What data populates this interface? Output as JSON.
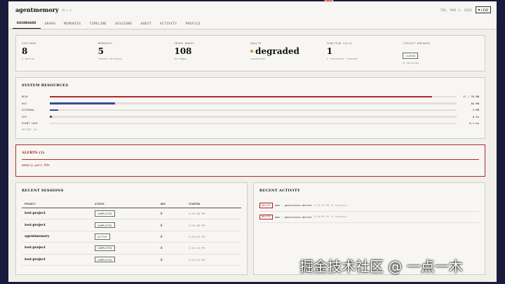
{
  "app": {
    "brand": "agentmemory",
    "version": "v0.x.x",
    "date": "TUE, MAR 3, 2026",
    "live_label": "LIVE"
  },
  "nav": [
    {
      "label": "DASHBOARD",
      "active": true
    },
    {
      "label": "GRAPH"
    },
    {
      "label": "MEMORIES"
    },
    {
      "label": "TIMELINE"
    },
    {
      "label": "SESSIONS"
    },
    {
      "label": "AUDIT"
    },
    {
      "label": "ACTIVITY"
    },
    {
      "label": "PROFILE"
    }
  ],
  "stats": {
    "sessions": {
      "label": "SESSIONS",
      "value": "8",
      "sub": "2 active"
    },
    "memories": {
      "label": "MEMORIES",
      "value": "5",
      "sub": "latest versions"
    },
    "graph": {
      "label": "GRAPH NODES",
      "value": "108",
      "sub": "84 edges"
    },
    "health": {
      "label": "HEALTH",
      "value": "degraded",
      "sub": "connected",
      "color": "#c8a24a"
    },
    "functions": {
      "label": "FUNCTION CALLS",
      "value": "1",
      "sub": "1 functions tracked"
    },
    "breaker": {
      "label": "CIRCUIT BREAKER",
      "value": "CLOSED",
      "sub": "0 failures"
    }
  },
  "resources": {
    "title": "SYSTEM RESOURCES",
    "rows": [
      {
        "label": "HEAP",
        "value": "17 / 18 MB",
        "fraction": 0.94,
        "color": "#b02a2a"
      },
      {
        "label": "RSS",
        "value": "84 MB",
        "fraction": 0.16,
        "color": "#3a4a9a"
      },
      {
        "label": "EXTERNAL",
        "value": "3 MB",
        "fraction": 0.02,
        "color": "#3a4a9a"
      },
      {
        "label": "CPU",
        "value": "0.5%",
        "fraction": 0.005,
        "color": "#555555"
      },
      {
        "label": "EVENT LOOP",
        "value": "0.1 ms",
        "fraction": 0.0,
        "color": "#555555"
      }
    ],
    "uptime": "UPTIME: 5m"
  },
  "alerts": {
    "title": "ALERTS (1)",
    "items": [
      "memory_warn_94%"
    ]
  },
  "sessions": {
    "title": "RECENT SESSIONS",
    "headers": [
      "PROJECT",
      "STATUS",
      "OBS",
      "STARTED"
    ],
    "rows": [
      {
        "project": "test-project",
        "status": "COMPLETED",
        "obs": "0",
        "started": "5:33:58 PM"
      },
      {
        "project": "test-project",
        "status": "COMPLETED",
        "obs": "0",
        "started": "5:33:58 PM"
      },
      {
        "project": "agentmemory",
        "status": "ACTIVE",
        "obs": "0",
        "started": "5:32:04 PM"
      },
      {
        "project": "test-project",
        "status": "COMPLETED",
        "obs": "0",
        "started": "5:12:33 PM"
      },
      {
        "project": "test-project",
        "status": "COMPLETED",
        "obs": "0",
        "started": "5:12:33 PM"
      }
    ]
  },
  "activity": {
    "title": "RECENT ACTIVITY",
    "items": [
      {
        "badge": "DELETE",
        "text": "mem · governance-delete",
        "meta": "5:16:15 PM (1 targets)"
      },
      {
        "badge": "DELETE",
        "text": "mem · governance-delete",
        "meta": "5:16:09 PM (1 targets)"
      }
    ]
  },
  "watermark": "掘金技术社区 @ 一点一木"
}
